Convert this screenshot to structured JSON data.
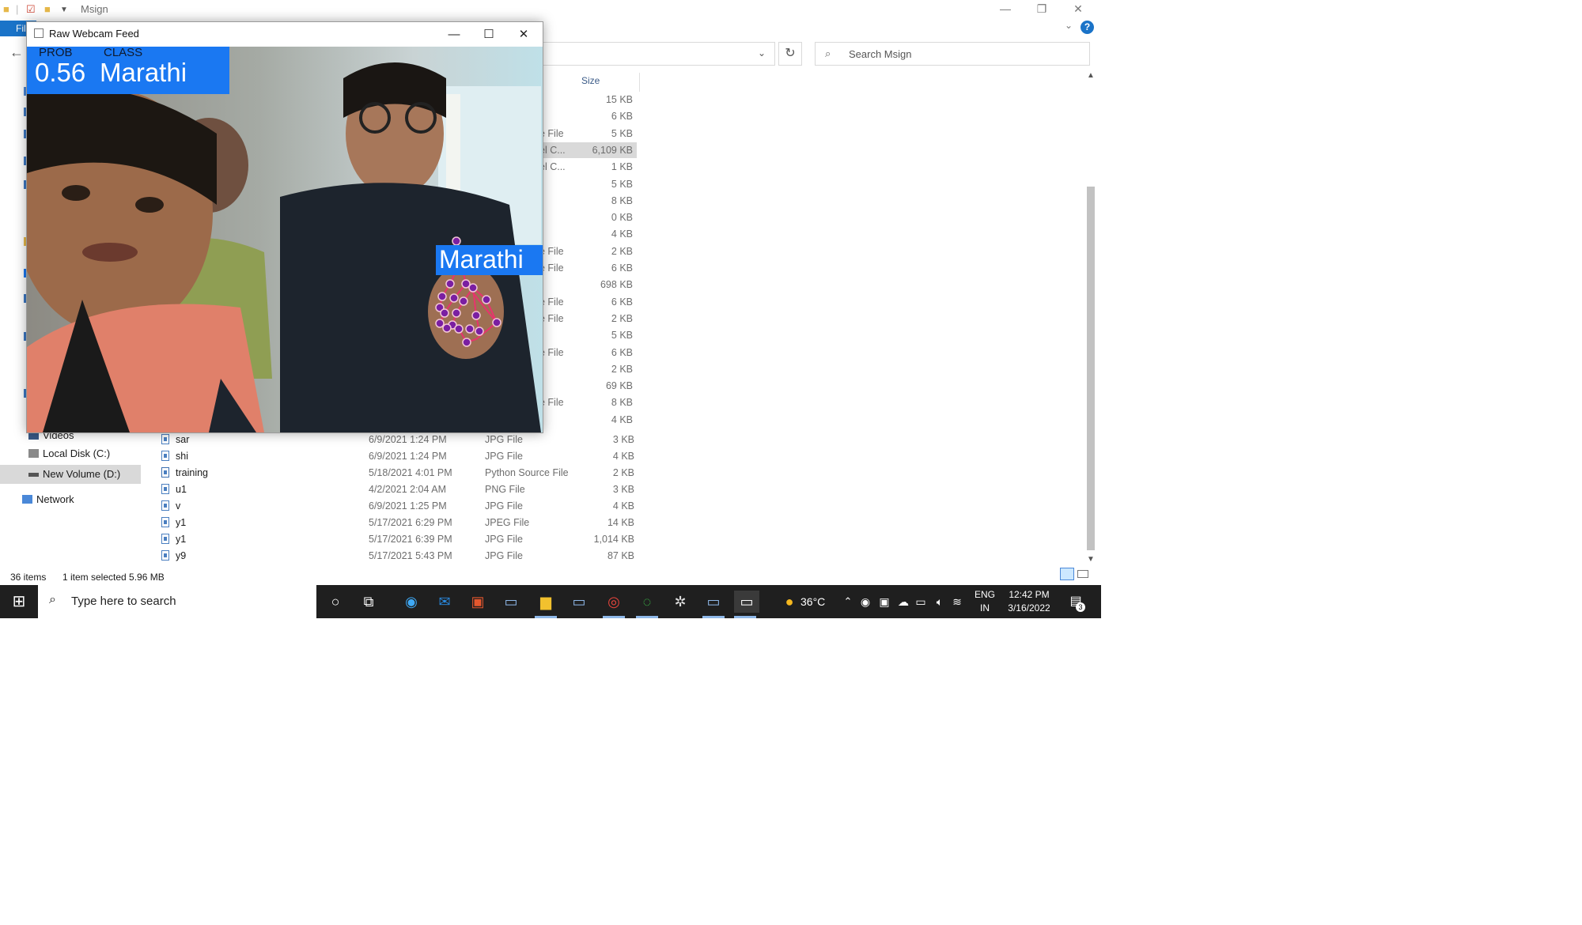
{
  "explorer": {
    "window_title": "Msign",
    "ribbon_file_tab": "File",
    "search_placeholder": "Search Msign",
    "column_size": "Size",
    "partial_rows": [
      {
        "type": "",
        "size": "15 KB"
      },
      {
        "type": "",
        "size": "6 KB"
      },
      {
        "type": "e File",
        "size": "5 KB"
      },
      {
        "type": "el C...",
        "size": "6,109 KB",
        "selected": true
      },
      {
        "type": "el C...",
        "size": "1 KB"
      },
      {
        "type": "",
        "size": "5 KB"
      },
      {
        "type": "",
        "size": "8 KB"
      },
      {
        "type": "",
        "size": "0 KB"
      },
      {
        "type": "",
        "size": "4 KB"
      },
      {
        "type": "e File",
        "size": "2 KB"
      },
      {
        "type": "e File",
        "size": "6 KB"
      },
      {
        "type": "",
        "size": "698 KB"
      },
      {
        "type": "e File",
        "size": "6 KB"
      },
      {
        "type": "e File",
        "size": "2 KB"
      },
      {
        "type": "",
        "size": "5 KB"
      },
      {
        "type": "e File",
        "size": "6 KB"
      },
      {
        "type": "",
        "size": "2 KB"
      },
      {
        "type": "",
        "size": "69 KB"
      },
      {
        "type": "e File",
        "size": "8 KB"
      },
      {
        "type": "",
        "size": "4 KB"
      }
    ],
    "files": [
      {
        "name": "sar",
        "date": "6/9/2021 1:24 PM",
        "type": "JPG File",
        "size": "3 KB"
      },
      {
        "name": "shi",
        "date": "6/9/2021 1:24 PM",
        "type": "JPG File",
        "size": "4 KB"
      },
      {
        "name": "training",
        "date": "5/18/2021 4:01 PM",
        "type": "Python Source File",
        "size": "2 KB"
      },
      {
        "name": "u1",
        "date": "4/2/2021 2:04 AM",
        "type": "PNG File",
        "size": "3 KB"
      },
      {
        "name": "v",
        "date": "6/9/2021 1:25 PM",
        "type": "JPG File",
        "size": "4 KB"
      },
      {
        "name": "y1",
        "date": "5/17/2021 6:29 PM",
        "type": "JPEG File",
        "size": "14 KB"
      },
      {
        "name": "y1",
        "date": "5/17/2021 6:39 PM",
        "type": "JPG File",
        "size": "1,014 KB"
      },
      {
        "name": "y9",
        "date": "5/17/2021 5:43 PM",
        "type": "JPG File",
        "size": "87 KB"
      }
    ],
    "nav": {
      "videos": "Videos",
      "local_disk": "Local Disk (C:)",
      "new_volume": "New Volume (D:)",
      "network": "Network"
    },
    "status": {
      "items": "36 items",
      "selected": "1 item selected  5.96 MB"
    }
  },
  "webcam": {
    "title": "Raw Webcam Feed",
    "prob_header": "PROB",
    "class_header": "CLASS",
    "prob_value": "0.56",
    "class_value": "Marathi",
    "hand_label": "Marathi"
  },
  "taskbar": {
    "search_placeholder": "Type here to search",
    "weather": "36°C",
    "lang_top": "ENG",
    "lang_bottom": "IN",
    "time": "12:42 PM",
    "date": "3/16/2022",
    "notifications": "3"
  },
  "colors": {
    "accent_blue": "#1a78f2",
    "hand_landmark": "#7a1fa2",
    "hand_connection": "#e8336d"
  }
}
